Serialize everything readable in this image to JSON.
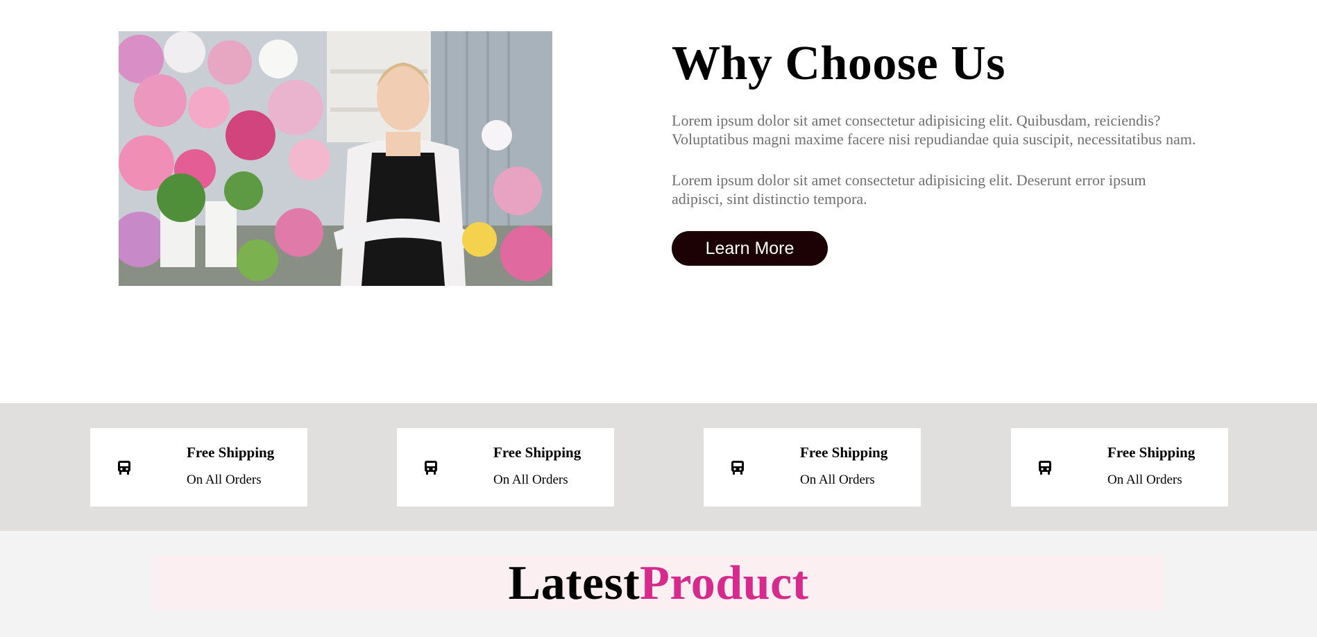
{
  "about": {
    "title": "Why Choose Us",
    "paragraph_1": "Lorem ipsum dolor sit amet consectetur adipisicing elit. Quibusdam, reiciendis? Voluptatibus magni maxime facere nisi repudiandae quia suscipit, necessitatibus nam.",
    "paragraph_2": "Lorem ipsum dolor sit amet consectetur adipisicing elit. Deserunt error ipsum adipisci, sint distinctio tempora.",
    "button_label": "Learn More",
    "image_icon": "florist-photo"
  },
  "features": [
    {
      "icon": "bus-icon",
      "title": "Free Shipping",
      "subtitle": "On All Orders"
    },
    {
      "icon": "bus-icon",
      "title": "Free Shipping",
      "subtitle": "On All Orders"
    },
    {
      "icon": "bus-icon",
      "title": "Free Shipping",
      "subtitle": "On All Orders"
    },
    {
      "icon": "bus-icon",
      "title": "Free Shipping",
      "subtitle": "On All Orders"
    }
  ],
  "latest": {
    "heading_part_1": "Latest",
    "heading_part_2": "Product"
  },
  "colors": {
    "button_bg": "#1c0205",
    "accent_pink": "#d62a8c",
    "features_bg": "#e1dede",
    "latest_bg": "#f4f3f3",
    "latest_bar": "#fbeff2"
  }
}
